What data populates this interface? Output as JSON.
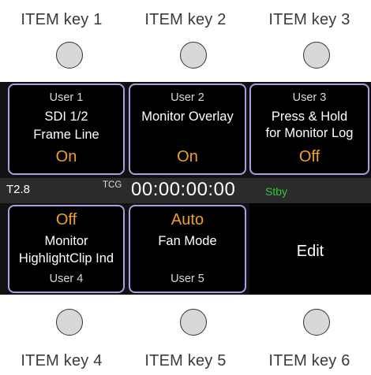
{
  "item_keys_top": [
    "ITEM key 1",
    "ITEM key 2",
    "ITEM key 3"
  ],
  "item_keys_bottom": [
    "ITEM key 4",
    "ITEM key 5",
    "ITEM key 6"
  ],
  "tiles": [
    {
      "user": "User 1",
      "line1": "SDI 1/2",
      "line2": "Frame Line",
      "state": "On"
    },
    {
      "user": "User 2",
      "line1": "Monitor Overlay",
      "line2": "",
      "state": "On"
    },
    {
      "user": "User 3",
      "line1": "Press & Hold",
      "line2": "for Monitor Log",
      "state": "Off"
    },
    {
      "user": "User 4",
      "line1": "Monitor",
      "line2": "HighlightClip Ind",
      "state": "Off"
    },
    {
      "user": "User 5",
      "line1": "Fan Mode",
      "line2": "",
      "state": "Auto"
    }
  ],
  "status": {
    "fstop": "T2.8",
    "tc_label": "TCG",
    "timecode": "00:00:00:00",
    "rec_state": "Stby"
  },
  "edit_label": "Edit",
  "colors": {
    "tile_border": "#a8a0e0",
    "state_orange": "#f0a028",
    "stby_green": "#2ec440",
    "panel_bg": "#111111"
  }
}
